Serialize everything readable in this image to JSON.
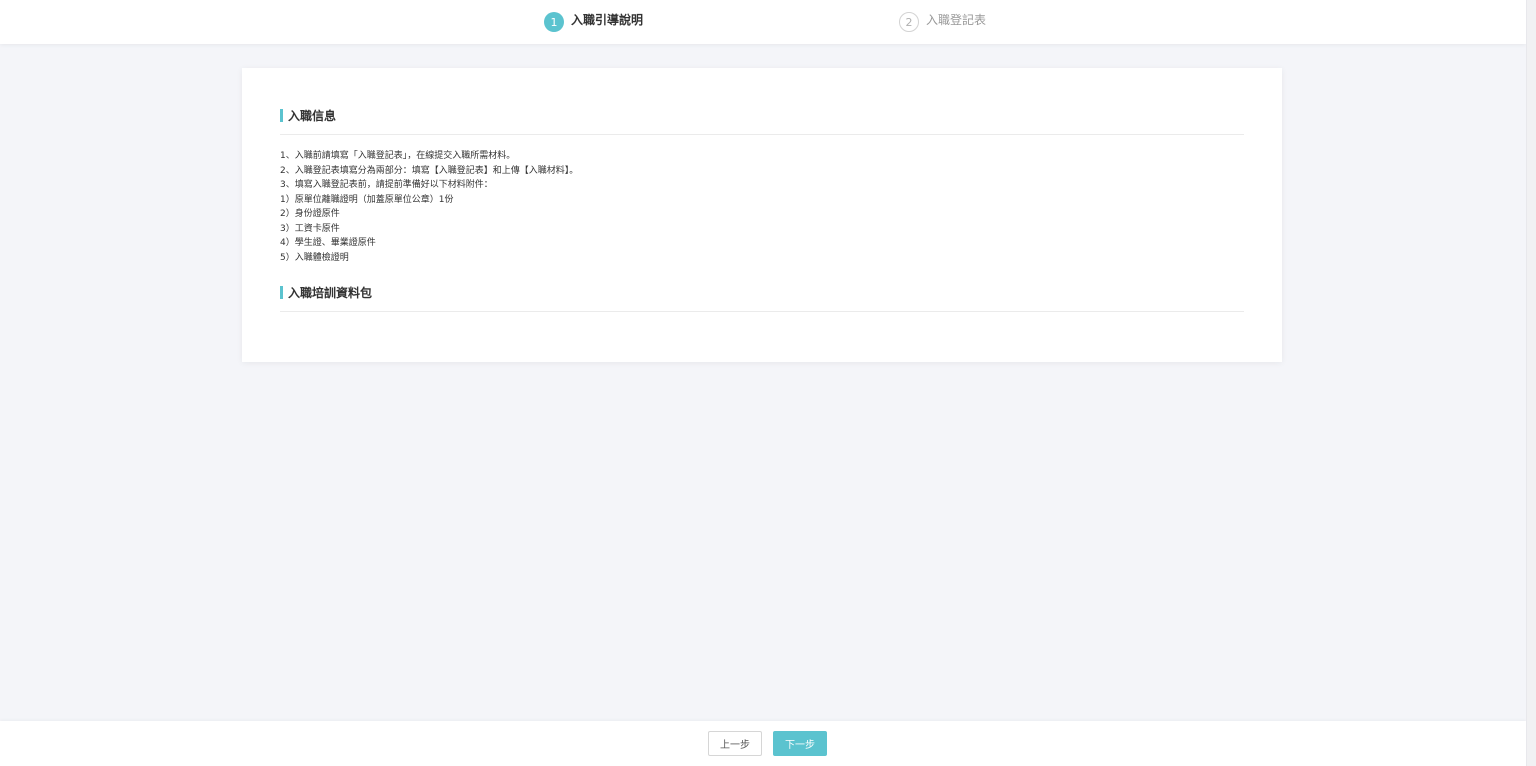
{
  "colors": {
    "accent": "#5bc3cf",
    "background": "#f4f5f9",
    "card": "#ffffff",
    "text": "#333333",
    "muted": "#999999"
  },
  "steps": [
    {
      "number": "1",
      "label": "入職引導說明",
      "state": "active"
    },
    {
      "number": "2",
      "label": "入職登記表",
      "state": "inactive"
    }
  ],
  "sections": {
    "info": {
      "title": "入職信息",
      "lines": [
        "1、入職前請填寫「入職登記表」，在線提交入職所需材料。",
        "2、入職登記表填寫分為兩部分：填寫【入職登記表】和上傳【入職材料】。",
        "3、填寫入職登記表前，請提前準備好以下材料附件：",
        "1）原單位離職證明（加蓋原單位公章）1份",
        "2）身份證原件",
        "3）工資卡原件",
        "4）學生證、畢業證原件",
        "5）入職體檢證明"
      ]
    },
    "training": {
      "title": "入職培訓資料包"
    }
  },
  "footer": {
    "prev_label": "上一步",
    "next_label": "下一步"
  }
}
